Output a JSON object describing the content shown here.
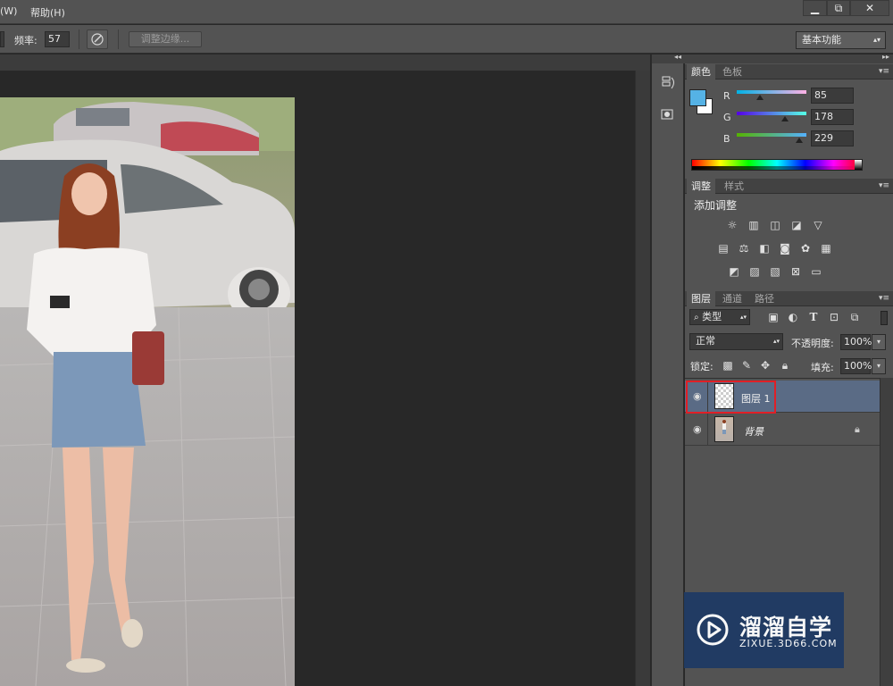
{
  "menubar": {
    "items": [
      {
        "label": "(W)"
      },
      {
        "label": "帮助(H)"
      }
    ],
    "window_buttons": {
      "minimize": "▁",
      "restore": "⧉",
      "close": "✕"
    }
  },
  "options": {
    "frequency_label": "频率:",
    "frequency_value": "57",
    "refine_edge_label": "调整边缘...",
    "workspace_value": "基本功能"
  },
  "color_panel": {
    "tabs": [
      {
        "label": "颜色"
      },
      {
        "label": "色板"
      }
    ],
    "channels": [
      {
        "label": "R",
        "value": "85",
        "fraction": 0.333
      },
      {
        "label": "G",
        "value": "178",
        "fraction": 0.698
      },
      {
        "label": "B",
        "value": "229",
        "fraction": 0.898
      }
    ],
    "foreground": "#55b2e5",
    "background": "#ffffff"
  },
  "adjust_panel": {
    "tabs": [
      {
        "label": "调整"
      },
      {
        "label": "样式"
      }
    ],
    "title": "添加调整"
  },
  "layers_panel": {
    "tabs": [
      {
        "label": "图层"
      },
      {
        "label": "通道"
      },
      {
        "label": "路径"
      }
    ],
    "filter_kind": "类型",
    "blend_mode": "正常",
    "opacity_label": "不透明度:",
    "opacity_value": "100%",
    "lock_label": "锁定:",
    "fill_label": "填充:",
    "fill_value": "100%",
    "layers": [
      {
        "name": "图层 1",
        "selected": true
      },
      {
        "name": "背景",
        "selected": false
      }
    ]
  },
  "watermark": {
    "brand": "溜溜自学",
    "url": "ZIXUE.3D66.COM"
  }
}
